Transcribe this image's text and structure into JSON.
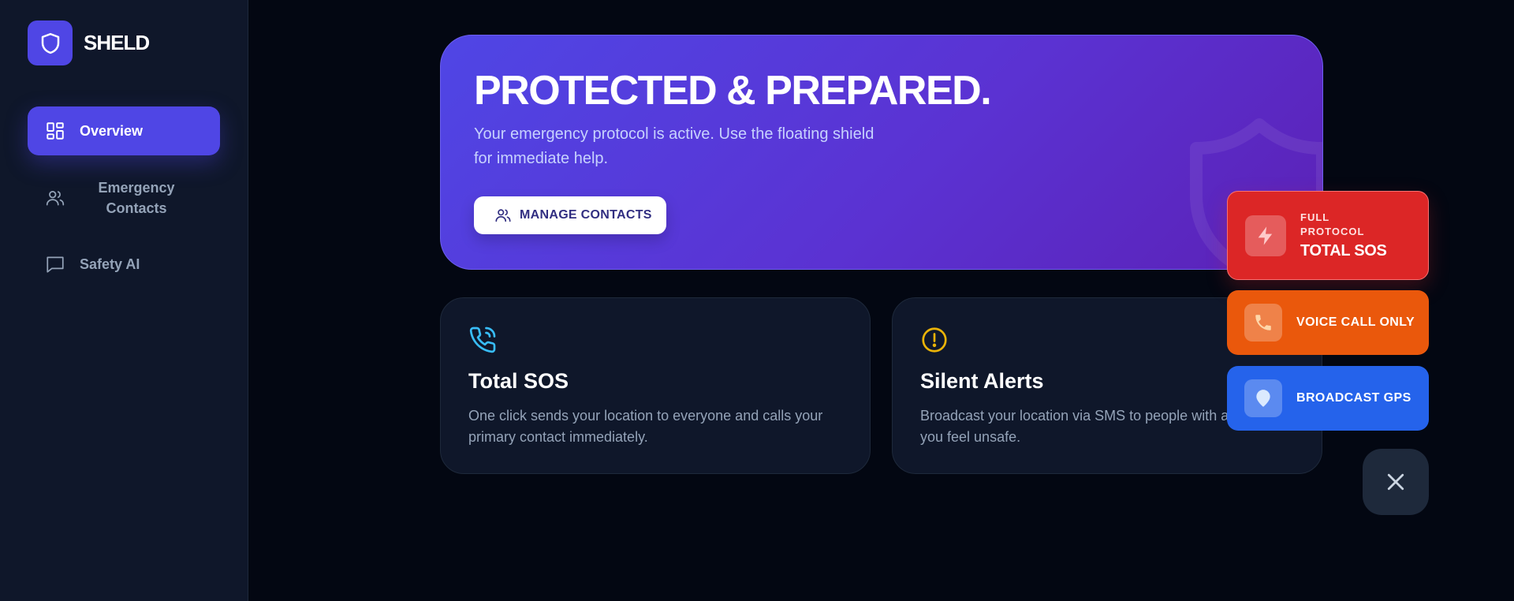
{
  "brand": {
    "name": "SHELD",
    "logo_icon": "shield-icon",
    "accent": "#4f46e5"
  },
  "sidebar": {
    "items": [
      {
        "label": "Overview",
        "icon": "dashboard-icon",
        "active": true
      },
      {
        "label": "Emergency Contacts",
        "icon": "users-icon",
        "active": false
      },
      {
        "label": "Safety AI",
        "icon": "chat-icon",
        "active": false
      }
    ]
  },
  "hero": {
    "title": "PROTECTED & PREPARED.",
    "subtitle": "Your emergency protocol is active. Use the floating shield for immediate help.",
    "button_label": "MANAGE CONTACTS",
    "button_icon": "users-icon"
  },
  "cards": [
    {
      "icon": "phone-call-icon",
      "icon_color": "#38bdf8",
      "title": "Total SOS",
      "description": "One click sends your location to everyone and calls your primary contact immediately."
    },
    {
      "icon": "alert-circle-icon",
      "icon_color": "#eab308",
      "title": "Silent Alerts",
      "description": "Broadcast your location via SMS to people with app silently if you feel unsafe."
    }
  ],
  "fab_menu": {
    "sos": {
      "eyebrow": "FULL PROTOCOL",
      "label": "TOTAL SOS",
      "icon": "lightning-icon",
      "color": "#dc2626"
    },
    "voice": {
      "label": "VOICE CALL ONLY",
      "icon": "phone-icon",
      "color": "#ea580c"
    },
    "gps": {
      "label": "BROADCAST GPS",
      "icon": "location-pin-icon",
      "color": "#2563eb"
    },
    "close_icon": "close-icon"
  }
}
